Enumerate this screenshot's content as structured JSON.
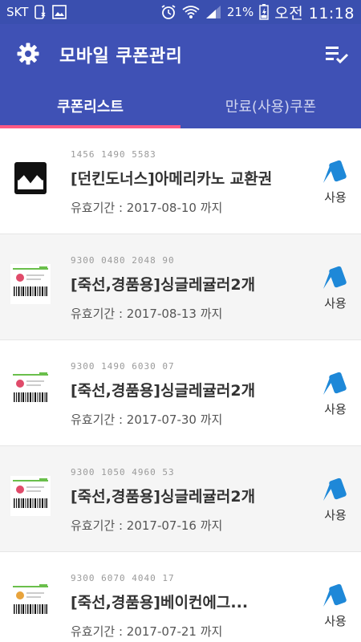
{
  "status_bar": {
    "carrier": "SKT",
    "battery": "21%",
    "time": "오전 11:18",
    "icons": [
      "phone-icon",
      "image-icon",
      "alarm-icon",
      "wifi-icon",
      "signal-icon",
      "battery-icon"
    ]
  },
  "app_bar": {
    "title": "모바일 쿠폰관리",
    "settings_icon": "gear-icon",
    "menu_icon": "playlist-check-icon"
  },
  "tabs": [
    {
      "label": "쿠폰리스트",
      "active": true
    },
    {
      "label": "만료(사용)쿠폰",
      "active": false
    }
  ],
  "colors": {
    "primary": "#3f51b5",
    "status_bar": "#3a4faf",
    "tab_indicator": "#ff5a84",
    "use_icon": "#1e88d8"
  },
  "coupons": [
    {
      "code": "1456 1490 5583",
      "title": "[던킨도너스]아메리카노 교환권",
      "validity": "유효기간 : 2017-08-10 까지",
      "thumb": "broken-image-icon",
      "action": "사용"
    },
    {
      "code": "9300 0480 2048 90",
      "title": "[죽선,경품용]싱글레귤러2개",
      "validity": "유효기간 : 2017-08-13 까지",
      "thumb": "coupon-barcode-thumbnail",
      "action": "사용"
    },
    {
      "code": "9300 1490 6030 07",
      "title": "[죽선,경품용]싱글레귤러2개",
      "validity": "유효기간 : 2017-07-30 까지",
      "thumb": "coupon-barcode-thumbnail",
      "action": "사용"
    },
    {
      "code": "9300 1050 4960 53",
      "title": "[죽선,경품용]싱글레귤러2개",
      "validity": "유효기간 : 2017-07-16 까지",
      "thumb": "coupon-barcode-thumbnail",
      "action": "사용"
    },
    {
      "code": "9300 6070 4040 17",
      "title": "[죽선,경품용]베이컨에그...",
      "validity": "유효기간 : 2017-07-21 까지",
      "thumb": "coupon-barcode-thumbnail",
      "action": "사용"
    }
  ]
}
